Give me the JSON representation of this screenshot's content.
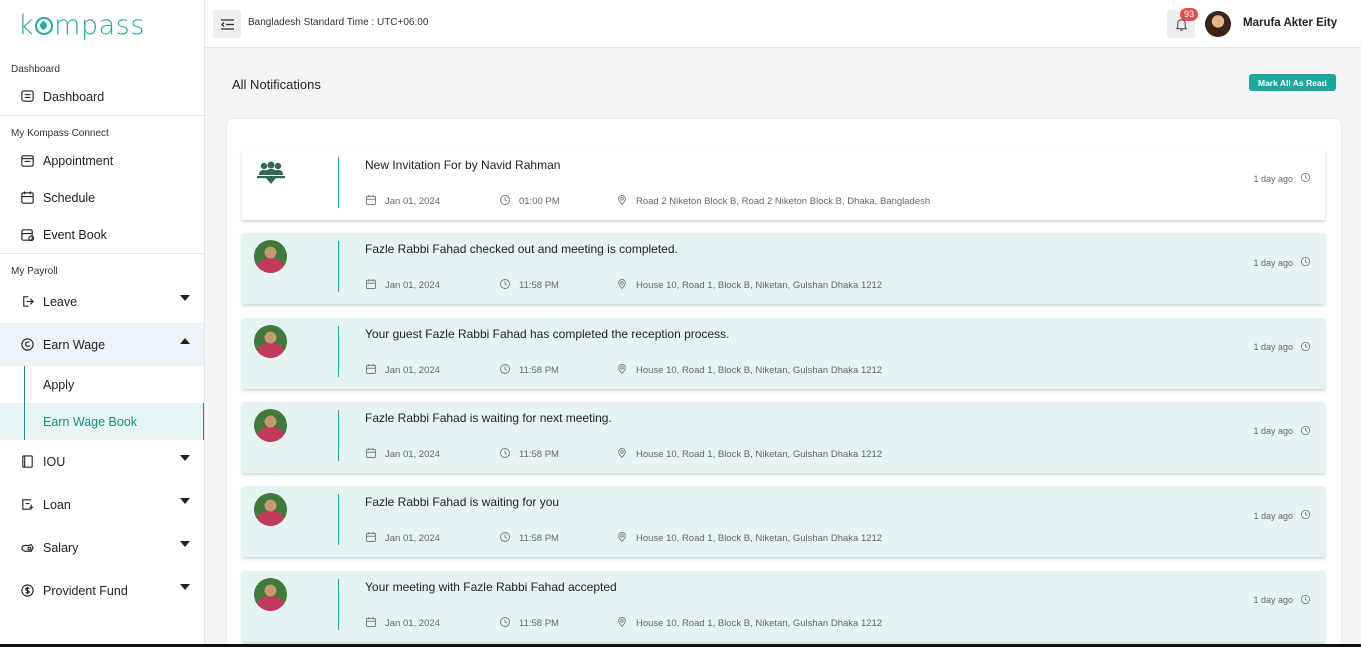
{
  "sidebar": {
    "logo": "kompass",
    "sections": {
      "dashboard": "Dashboard",
      "connect": "My Kompass Connect",
      "payroll": "My Payroll"
    },
    "items": {
      "dashboard": "Dashboard",
      "appointment": "Appointment",
      "schedule": "Schedule",
      "event_book": "Event Book",
      "leave": "Leave",
      "earn_wage": "Earn Wage",
      "apply": "Apply",
      "earn_wage_book": "Earn Wage Book",
      "iou": "IOU",
      "loan": "Loan",
      "salary": "Salary",
      "provident_fund": "Provident Fund"
    }
  },
  "header": {
    "timezone": "Bangladesh Standard Time : UTC+06:00",
    "notification_count": "93",
    "user_name": "Marufa Akter Eity"
  },
  "main": {
    "title": "All Notifications",
    "mark_all_label": "Mark All As Read",
    "notifications": [
      {
        "title": "New Invitation For by Navid Rahman",
        "date": "Jan 01, 2024",
        "time": "01:00 PM",
        "location": "Road 2 Niketon Block B, Road 2 Niketon Block B, Dhaka, Bangladesh",
        "ago": "1 day ago",
        "read": true,
        "icon": "group-icon"
      },
      {
        "title": "Fazle Rabbi Fahad checked out and meeting is completed.",
        "date": "Jan 01, 2024",
        "time": "11:58 PM",
        "location": "House 10, Road 1, Block B, Niketan, Gulshan Dhaka 1212",
        "ago": "1 day ago",
        "read": false,
        "icon": "person-avatar"
      },
      {
        "title": "Your guest Fazle Rabbi Fahad has completed the reception process.",
        "date": "Jan 01, 2024",
        "time": "11:58 PM",
        "location": "House 10, Road 1, Block B, Niketan, Gulshan Dhaka 1212",
        "ago": "1 day ago",
        "read": false,
        "icon": "person-avatar"
      },
      {
        "title": "Fazle Rabbi Fahad is waiting for next meeting.",
        "date": "Jan 01, 2024",
        "time": "11:58 PM",
        "location": "House 10, Road 1, Block B, Niketan, Gulshan Dhaka 1212",
        "ago": "1 day ago",
        "read": false,
        "icon": "person-avatar"
      },
      {
        "title": "Fazle Rabbi Fahad is waiting for you",
        "date": "Jan 01, 2024",
        "time": "11:58 PM",
        "location": "House 10, Road 1, Block B, Niketan, Gulshan Dhaka 1212",
        "ago": "1 day ago",
        "read": false,
        "icon": "person-avatar"
      },
      {
        "title": "Your meeting with Fazle Rabbi Fahad accepted",
        "date": "Jan 01, 2024",
        "time": "11:58 PM",
        "location": "House 10, Road 1, Block B, Niketan, Gulshan Dhaka 1212",
        "ago": "1 day ago",
        "read": false,
        "icon": "person-avatar"
      }
    ]
  },
  "colors": {
    "accent": "#1aa89e",
    "unread_bg": "#e5f4f3",
    "badge": "#e74c4c"
  }
}
